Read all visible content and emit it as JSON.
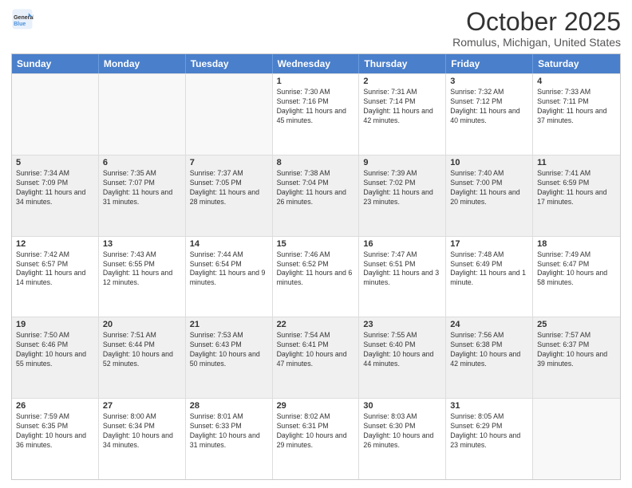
{
  "header": {
    "logo_line1": "General",
    "logo_line2": "Blue",
    "month": "October 2025",
    "location": "Romulus, Michigan, United States"
  },
  "days_of_week": [
    "Sunday",
    "Monday",
    "Tuesday",
    "Wednesday",
    "Thursday",
    "Friday",
    "Saturday"
  ],
  "rows": [
    [
      {
        "day": "",
        "empty": true
      },
      {
        "day": "",
        "empty": true
      },
      {
        "day": "",
        "empty": true
      },
      {
        "day": "1",
        "sunrise": "7:30 AM",
        "sunset": "7:16 PM",
        "daylight": "11 hours and 45 minutes."
      },
      {
        "day": "2",
        "sunrise": "7:31 AM",
        "sunset": "7:14 PM",
        "daylight": "11 hours and 42 minutes."
      },
      {
        "day": "3",
        "sunrise": "7:32 AM",
        "sunset": "7:12 PM",
        "daylight": "11 hours and 40 minutes."
      },
      {
        "day": "4",
        "sunrise": "7:33 AM",
        "sunset": "7:11 PM",
        "daylight": "11 hours and 37 minutes."
      }
    ],
    [
      {
        "day": "5",
        "sunrise": "7:34 AM",
        "sunset": "7:09 PM",
        "daylight": "11 hours and 34 minutes."
      },
      {
        "day": "6",
        "sunrise": "7:35 AM",
        "sunset": "7:07 PM",
        "daylight": "11 hours and 31 minutes."
      },
      {
        "day": "7",
        "sunrise": "7:37 AM",
        "sunset": "7:05 PM",
        "daylight": "11 hours and 28 minutes."
      },
      {
        "day": "8",
        "sunrise": "7:38 AM",
        "sunset": "7:04 PM",
        "daylight": "11 hours and 26 minutes."
      },
      {
        "day": "9",
        "sunrise": "7:39 AM",
        "sunset": "7:02 PM",
        "daylight": "11 hours and 23 minutes."
      },
      {
        "day": "10",
        "sunrise": "7:40 AM",
        "sunset": "7:00 PM",
        "daylight": "11 hours and 20 minutes."
      },
      {
        "day": "11",
        "sunrise": "7:41 AM",
        "sunset": "6:59 PM",
        "daylight": "11 hours and 17 minutes."
      }
    ],
    [
      {
        "day": "12",
        "sunrise": "7:42 AM",
        "sunset": "6:57 PM",
        "daylight": "11 hours and 14 minutes."
      },
      {
        "day": "13",
        "sunrise": "7:43 AM",
        "sunset": "6:55 PM",
        "daylight": "11 hours and 12 minutes."
      },
      {
        "day": "14",
        "sunrise": "7:44 AM",
        "sunset": "6:54 PM",
        "daylight": "11 hours and 9 minutes."
      },
      {
        "day": "15",
        "sunrise": "7:46 AM",
        "sunset": "6:52 PM",
        "daylight": "11 hours and 6 minutes."
      },
      {
        "day": "16",
        "sunrise": "7:47 AM",
        "sunset": "6:51 PM",
        "daylight": "11 hours and 3 minutes."
      },
      {
        "day": "17",
        "sunrise": "7:48 AM",
        "sunset": "6:49 PM",
        "daylight": "11 hours and 1 minute."
      },
      {
        "day": "18",
        "sunrise": "7:49 AM",
        "sunset": "6:47 PM",
        "daylight": "10 hours and 58 minutes."
      }
    ],
    [
      {
        "day": "19",
        "sunrise": "7:50 AM",
        "sunset": "6:46 PM",
        "daylight": "10 hours and 55 minutes."
      },
      {
        "day": "20",
        "sunrise": "7:51 AM",
        "sunset": "6:44 PM",
        "daylight": "10 hours and 52 minutes."
      },
      {
        "day": "21",
        "sunrise": "7:53 AM",
        "sunset": "6:43 PM",
        "daylight": "10 hours and 50 minutes."
      },
      {
        "day": "22",
        "sunrise": "7:54 AM",
        "sunset": "6:41 PM",
        "daylight": "10 hours and 47 minutes."
      },
      {
        "day": "23",
        "sunrise": "7:55 AM",
        "sunset": "6:40 PM",
        "daylight": "10 hours and 44 minutes."
      },
      {
        "day": "24",
        "sunrise": "7:56 AM",
        "sunset": "6:38 PM",
        "daylight": "10 hours and 42 minutes."
      },
      {
        "day": "25",
        "sunrise": "7:57 AM",
        "sunset": "6:37 PM",
        "daylight": "10 hours and 39 minutes."
      }
    ],
    [
      {
        "day": "26",
        "sunrise": "7:59 AM",
        "sunset": "6:35 PM",
        "daylight": "10 hours and 36 minutes."
      },
      {
        "day": "27",
        "sunrise": "8:00 AM",
        "sunset": "6:34 PM",
        "daylight": "10 hours and 34 minutes."
      },
      {
        "day": "28",
        "sunrise": "8:01 AM",
        "sunset": "6:33 PM",
        "daylight": "10 hours and 31 minutes."
      },
      {
        "day": "29",
        "sunrise": "8:02 AM",
        "sunset": "6:31 PM",
        "daylight": "10 hours and 29 minutes."
      },
      {
        "day": "30",
        "sunrise": "8:03 AM",
        "sunset": "6:30 PM",
        "daylight": "10 hours and 26 minutes."
      },
      {
        "day": "31",
        "sunrise": "8:05 AM",
        "sunset": "6:29 PM",
        "daylight": "10 hours and 23 minutes."
      },
      {
        "day": "",
        "empty": true
      }
    ]
  ]
}
